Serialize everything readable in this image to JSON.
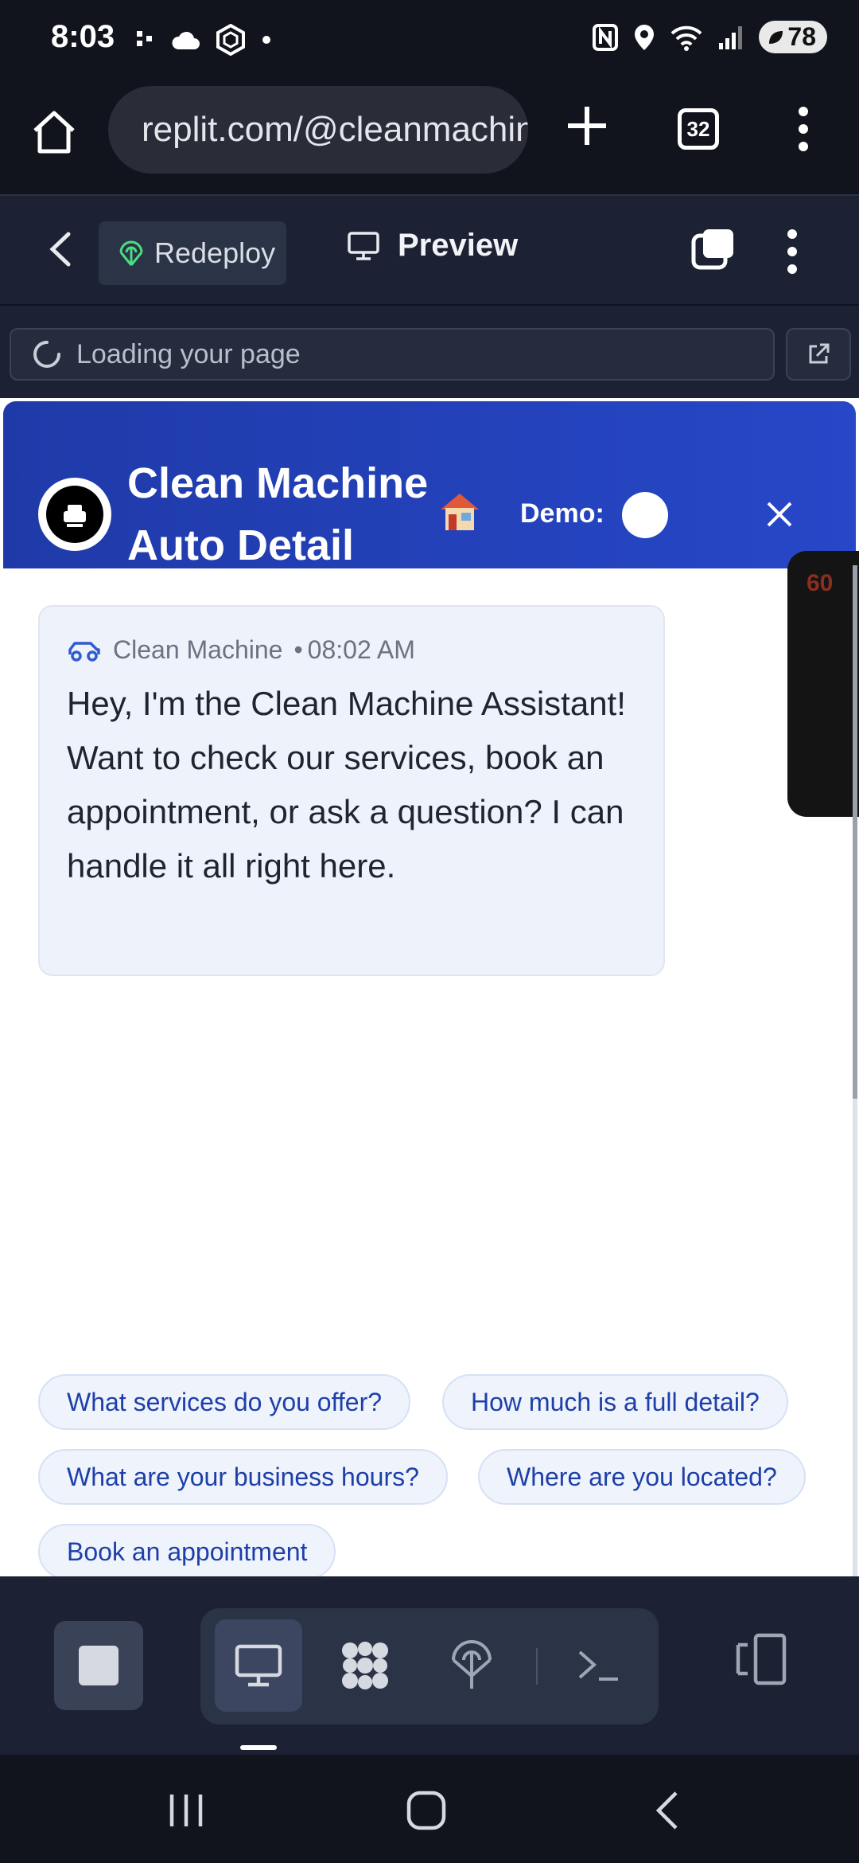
{
  "status_bar": {
    "time": "8:03",
    "battery": "78",
    "left_icons": [
      "tailscale-icon",
      "cloud-icon",
      "app-icon",
      "dot-icon"
    ],
    "right_icons": [
      "nfc-icon",
      "location-icon",
      "wifi-icon",
      "signal-icon"
    ]
  },
  "browser": {
    "url": "replit.com/@cleanmachine",
    "tab_count": "32"
  },
  "replit_header": {
    "redeploy_label": "Redeploy",
    "preview_label": "Preview",
    "loading_text": "Loading your page"
  },
  "chat": {
    "title_line1": "Clean Machine",
    "title_line2": "Auto Detail",
    "demo_label": "Demo:",
    "message": {
      "sender": "Clean Machine",
      "time": "08:02 AM",
      "separator": "•",
      "text": "Hey, I'm the Clean Machine Assistant! Want to check our services, book an appointment, or ask a question? I can handle it all right here."
    },
    "suggestions": [
      "What services do you offer?",
      "How much is a full detail?",
      "What are your business hours?",
      "Where are you located?",
      "Book an appointment"
    ],
    "side_thumb_label": "60"
  },
  "colors": {
    "header_blue": "#2747c8",
    "chip_text": "#1e3fa8",
    "replit_bg": "#1c2233",
    "browser_bg": "#12141d"
  }
}
